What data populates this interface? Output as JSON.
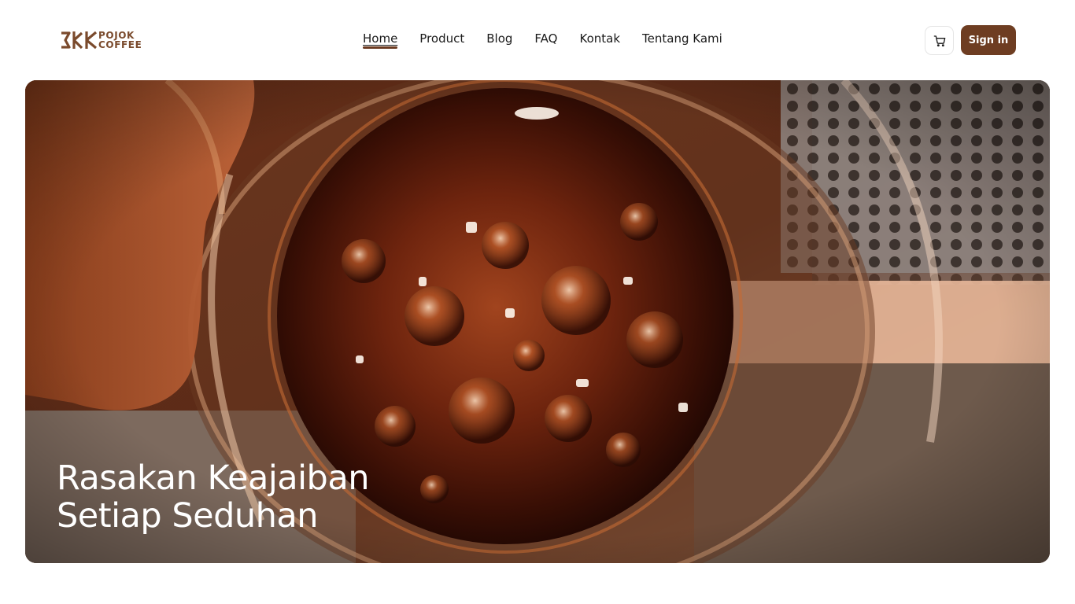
{
  "brand": {
    "line1": "POJOK",
    "line2": "COFFEE",
    "color": "#7a4a2c"
  },
  "nav": {
    "items": [
      {
        "label": "Home",
        "active": true
      },
      {
        "label": "Product"
      },
      {
        "label": "Blog"
      },
      {
        "label": "FAQ"
      },
      {
        "label": "Kontak"
      },
      {
        "label": "Tentang Kami"
      }
    ],
    "active_underline_color": "#6b3a21"
  },
  "actions": {
    "cart_icon": "shopping-cart-icon",
    "signin_label": "Sign in",
    "signin_color": "#6e3d22"
  },
  "hero": {
    "title_line1": "Rasakan Keajaiban",
    "title_line2": "Setiap Seduhan",
    "image_subject": "coffee-glass-pour-photo"
  }
}
